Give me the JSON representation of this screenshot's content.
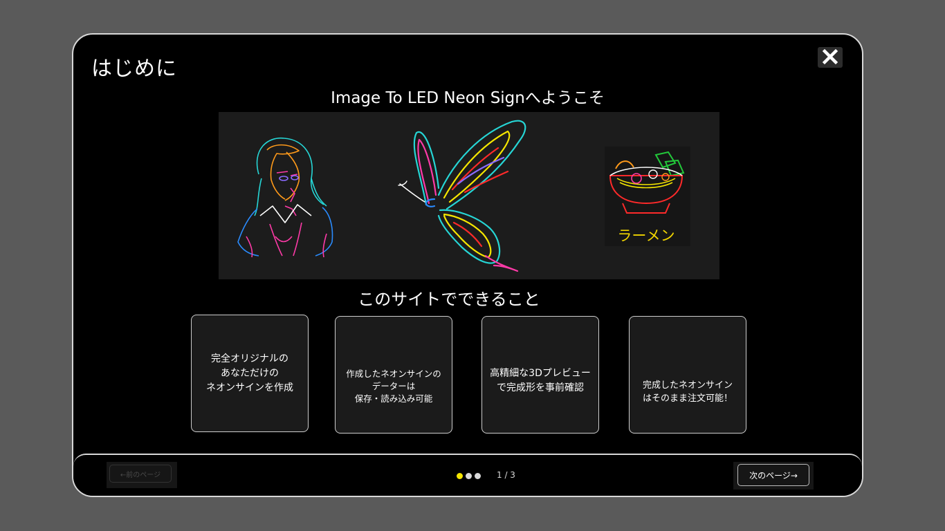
{
  "modal": {
    "title": "はじめに",
    "welcome": "Image To LED Neon Signへようこそ",
    "ramen_label": "ラーメン",
    "subheading": "このサイトでできること"
  },
  "icons": {
    "close": "close-icon"
  },
  "features": [
    {
      "lines": [
        "完全オリジナルの",
        "あなただけの",
        "ネオンサインを作成"
      ]
    },
    {
      "lines": [
        "作成したネオンサインの",
        "データーは",
        "保存・読み込み可能"
      ]
    },
    {
      "lines": [
        "高精細な3Dプレビュー",
        "で完成形を事前確認"
      ]
    },
    {
      "lines": [
        "完成したネオンサイン",
        "はそのまま注文可能！"
      ]
    }
  ],
  "footer": {
    "prev_label": "←前のページ",
    "next_label": "次のページ→",
    "page_indicator": "1 / 3",
    "dot_colors": [
      "#f5e600",
      "#d9d9d9",
      "#d9d9d9"
    ]
  }
}
